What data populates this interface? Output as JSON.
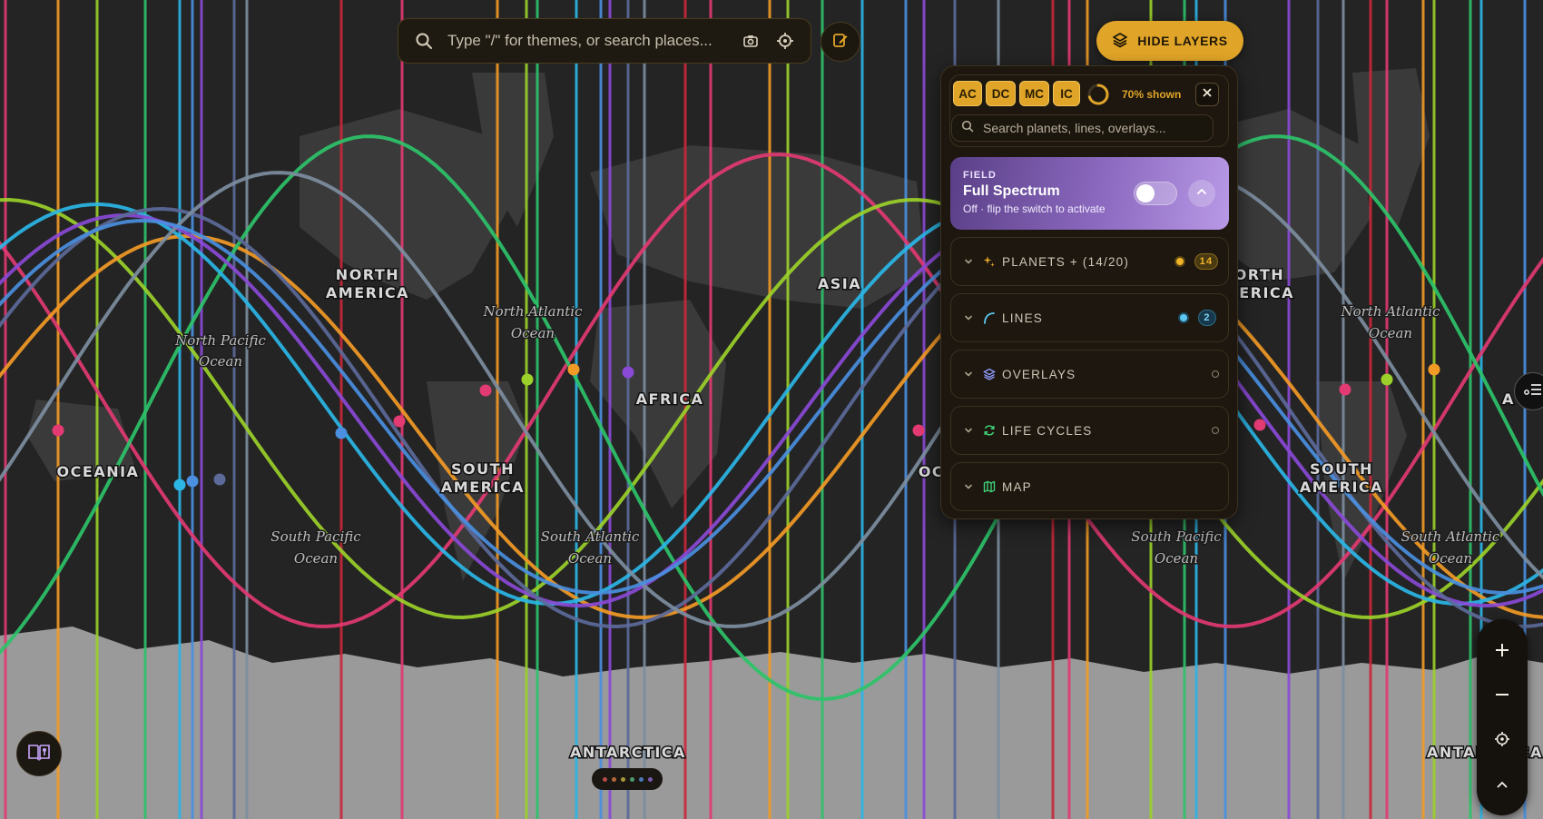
{
  "search": {
    "placeholder": "Type \"/\" for themes, or search places..."
  },
  "buttons": {
    "hide_layers": "HIDE LAYERS"
  },
  "panel": {
    "angle_chips": [
      "AC",
      "DC",
      "MC",
      "IC"
    ],
    "shown_text": "70% shown",
    "shown_fraction": 0.7,
    "search_placeholder": "Search planets, lines, overlays...",
    "field": {
      "kicker": "FIELD",
      "title": "Full Spectrum",
      "subtitle": "Off · flip the switch to activate",
      "toggle_on": false
    },
    "sections": [
      {
        "label": "PLANETS + (14/20)",
        "icon": "sparkle-icon",
        "icon_color": "#e0a528",
        "dot_color": "#f0b429",
        "badge": "14"
      },
      {
        "label": "LINES",
        "icon": "curve-line-icon",
        "icon_color": "#5cc8f2",
        "dot_color": "#5cc8f2",
        "badge": "2"
      },
      {
        "label": "OVERLAYS",
        "icon": "layers-icon",
        "icon_color": "#8f9bff",
        "dot_color": "",
        "badge": ""
      },
      {
        "label": "LIFE CYCLES",
        "icon": "refresh-icon",
        "icon_color": "#3fcf76",
        "dot_color": "",
        "badge": ""
      },
      {
        "label": "MAP",
        "icon": "map-icon",
        "icon_color": "#3fcf76",
        "dot_color": "",
        "badge": ""
      }
    ]
  },
  "map_labels": {
    "north_america_1": "NORTH",
    "north_america_2": "AMERICA",
    "north_america_b1": "NORTH",
    "north_america_b2": "AMERICA",
    "asia": "ASIA",
    "africa": "AFRICA",
    "south_america_1": "SOUTH",
    "south_america_2": "AMERICA",
    "south_america_b1": "SOUTH",
    "south_america_b2": "AMERICA",
    "oceania": "OCEANIA",
    "antarctica": "ANTARCTICA",
    "antarctica_b": "ANTARCTICA",
    "oceania_partial": "OC",
    "right_partial": "A",
    "north_pacific_1": "North Pacific",
    "north_pacific_2": "Ocean",
    "north_atlantic_1": "North Atlantic",
    "north_atlantic_2": "Ocean",
    "north_atlantic_b1": "North Atlantic",
    "north_atlantic_b2": "Ocean",
    "south_pacific_1": "South Pacific",
    "south_pacific_2": "Ocean",
    "south_pacific_b1": "South Pacific",
    "south_pacific_b2": "Ocean",
    "south_atlantic_1": "South Atlantic",
    "south_atlantic_2": "Ocean",
    "south_atlantic_b1": "South Atlantic",
    "south_atlantic_b2": "Ocean"
  },
  "colors": {
    "accent": "#e0a528",
    "planet_palette": [
      "#e23a72",
      "#f29a26",
      "#9bd12a",
      "#2ec36a",
      "#2bb6e6",
      "#4a8fe0",
      "#8a4ad6",
      "#5c6a9a",
      "#7d8ea0",
      "#c7283a"
    ]
  }
}
